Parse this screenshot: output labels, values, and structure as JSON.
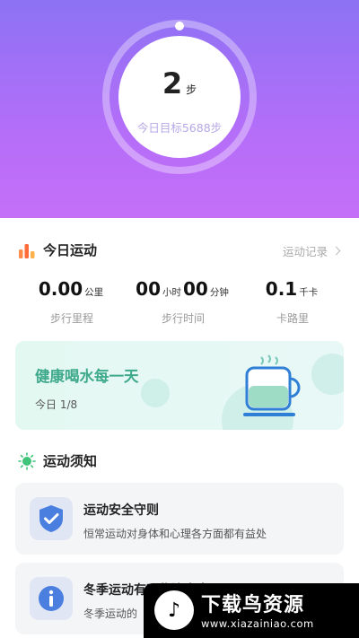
{
  "hero": {
    "steps_value": "2",
    "steps_unit": "步",
    "goal_text": "今日目标5688步"
  },
  "today": {
    "title": "今日运动",
    "record_link": "运动记录",
    "stats": [
      {
        "value": "0.00",
        "unit": "公里",
        "label": "步行里程"
      },
      {
        "value_h": "00",
        "unit_h": "小时",
        "value_m": "00",
        "unit_m": "分钟",
        "label": "步行时间"
      },
      {
        "value": "0.1",
        "unit": "千卡",
        "label": "卡路里"
      }
    ]
  },
  "water": {
    "title": "健康喝水每一天",
    "progress_text": "今日 1/8",
    "progress": 0.125
  },
  "notice": {
    "title": "运动须知",
    "items": [
      {
        "title": "运动安全守则",
        "desc": "恒常运动对身体和心理各方面都有益处",
        "icon": "shield-check-icon"
      },
      {
        "title": "冬季运动有哪些注意事项",
        "desc": "冬季运动的",
        "icon": "info-icon"
      }
    ]
  },
  "watermark": {
    "name": "下载鸟资源",
    "url": "www.xiazainiao.com"
  },
  "colors": {
    "hero_top": "#8c72f4",
    "hero_bottom": "#c56ff8",
    "water_title": "#3fa98b",
    "goal_text": "#b7a8e6"
  }
}
